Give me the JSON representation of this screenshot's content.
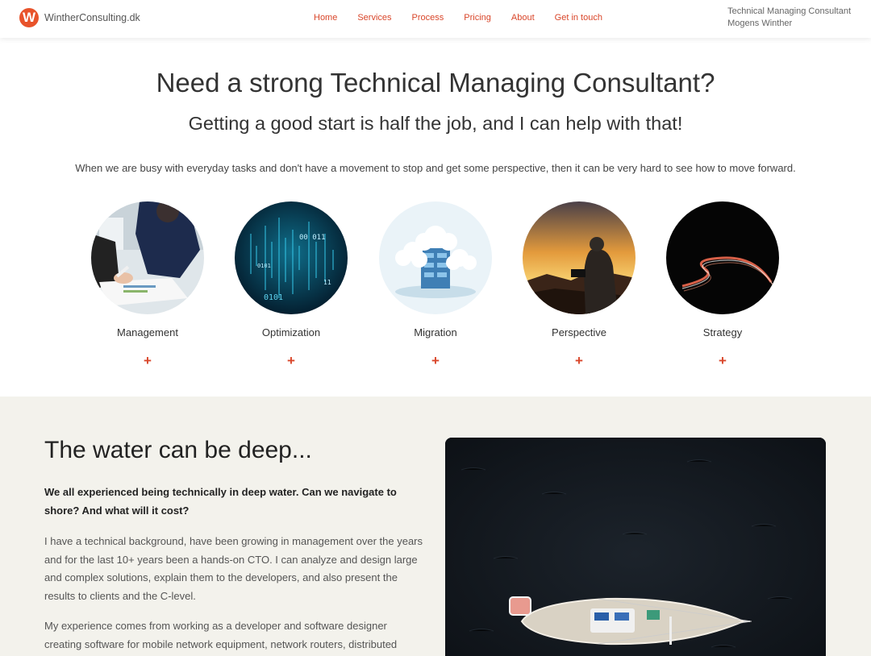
{
  "brand": {
    "logo_letter": "W",
    "name": "WintherConsulting.dk"
  },
  "nav": [
    "Home",
    "Services",
    "Process",
    "Pricing",
    "About",
    "Get in touch"
  ],
  "header_right": {
    "line1": "Technical Managing Consultant",
    "line2": "Mogens Winther"
  },
  "hero": {
    "title": "Need a strong Technical Managing Consultant?",
    "subtitle": "Getting a good start is half the job, and I can help with that!",
    "text": "When we are busy with everyday tasks and don't have a movement to stop and get some perspective, then it can be very hard to see how to move forward."
  },
  "services": [
    {
      "label": "Management",
      "icon": "plus-icon",
      "expand": "+"
    },
    {
      "label": "Optimization",
      "icon": "plus-icon",
      "expand": "+"
    },
    {
      "label": "Migration",
      "icon": "plus-icon",
      "expand": "+"
    },
    {
      "label": "Perspective",
      "icon": "plus-icon",
      "expand": "+"
    },
    {
      "label": "Strategy",
      "icon": "plus-icon",
      "expand": "+"
    }
  ],
  "binary_text": {
    "a": "00 011",
    "b": "0101",
    "c": "11",
    "d": "0101"
  },
  "section": {
    "title": "The water can be deep...",
    "lead": "We all experienced being technically in deep water. Can we navigate to shore? And what will it cost?",
    "p1": "I have a technical background, have been growing in management over the years and for the last 10+ years been a hands-on CTO. I can analyze and design large and complex solutions, explain them to the developers, and also present the results to clients and the C-level.",
    "p2": "My experience comes from working as a developer and software designer creating software for mobile network equipment, network routers, distributed systems, and"
  },
  "colors": {
    "accent": "#d9462a",
    "section_bg": "#f3f2ec"
  }
}
